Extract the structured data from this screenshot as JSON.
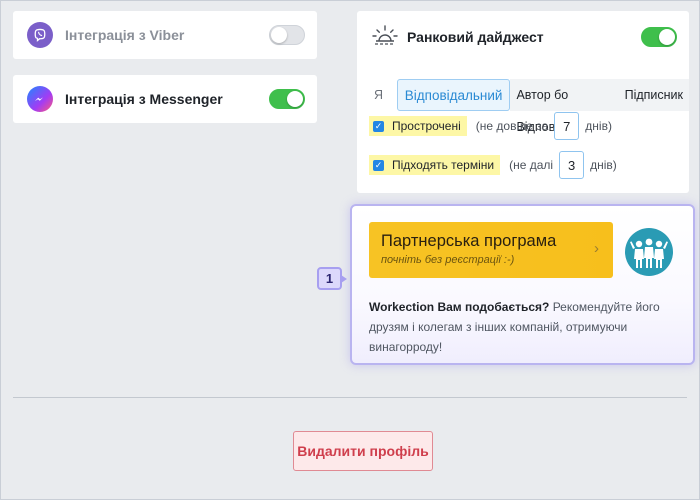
{
  "integrations": {
    "viber": {
      "label": "Інтеграція з Viber",
      "enabled": false
    },
    "messenger": {
      "label": "Інтеграція з Messenger",
      "enabled": true
    }
  },
  "digest": {
    "title": "Ранковий дайджест",
    "enabled": true,
    "role_options": [
      "Я",
      "Відповідальний",
      "Автор бо Відпов.",
      "Підписник"
    ],
    "selected_role": "Відповідальний",
    "overdue": {
      "label": "Прострочені",
      "checked": true,
      "prefix": "(не довше за",
      "value": "7",
      "suffix": "днів)"
    },
    "upcoming": {
      "label": "Підходять терміни",
      "checked": true,
      "prefix": "(не далі",
      "value": "3",
      "suffix": "днів)"
    }
  },
  "partner": {
    "title": "Партнерська програма",
    "subtitle": "почніть без реєстрації :-)",
    "question": "Workection Вам подобається?",
    "body": "Рекомендуйте його друзям і колегам з інших компаній, отримуючи винагорроду!"
  },
  "marker": "1",
  "delete_label": "Видалити профіль",
  "colors": {
    "accent_green": "#3fbf4c",
    "viber": "#7b5fc9",
    "partner_yellow": "#f7c324",
    "danger": "#cf3e4c"
  }
}
